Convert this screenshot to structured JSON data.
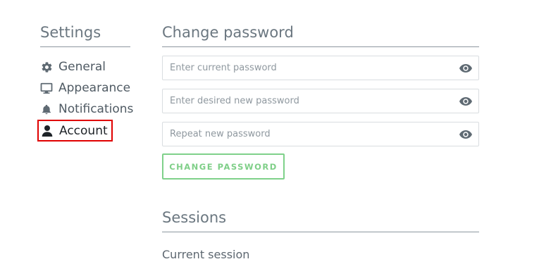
{
  "sidebar": {
    "title": "Settings",
    "items": [
      {
        "label": "General",
        "icon": "gear-icon"
      },
      {
        "label": "Appearance",
        "icon": "monitor-icon"
      },
      {
        "label": "Notifications",
        "icon": "bell-icon"
      },
      {
        "label": "Account",
        "icon": "user-icon",
        "selected": true
      }
    ]
  },
  "change_password": {
    "title": "Change password",
    "fields": [
      {
        "placeholder": "Enter current password"
      },
      {
        "placeholder": "Enter desired new password"
      },
      {
        "placeholder": "Repeat new password"
      }
    ],
    "button_label": "CHANGE PASSWORD"
  },
  "sessions": {
    "title": "Sessions",
    "current_label": "Current session"
  },
  "colors": {
    "accent_green": "#7fd18a",
    "selection_outline": "#e00000",
    "text": "#4f5a63"
  }
}
